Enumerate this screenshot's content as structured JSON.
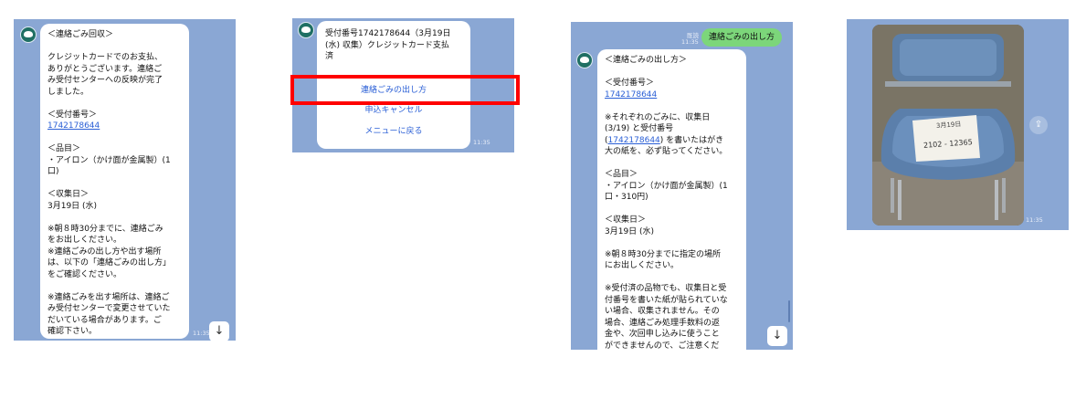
{
  "panel1": {
    "lines": [
      "＜連絡ごみ回収＞",
      "",
      "クレジットカードでのお支払、",
      "ありがとうございます。連絡ご",
      "み受付センターへの反映が完了",
      "しました。",
      "",
      "＜受付番号＞"
    ],
    "receipt_link": "1742178644",
    "lines2": [
      "",
      "＜品目＞",
      "・アイロン（かけ面が金属製）(1",
      "口)",
      "",
      "＜収集日＞",
      "3月19日 (水)",
      "",
      "※朝８時30分までに、連絡ごみ",
      "をお出しください。",
      "※連絡ごみの出し方や出す場所",
      "は、以下の「連絡ごみの出し方」",
      "をご確認ください。",
      "",
      "※連絡ごみを出す場所は、連絡ご",
      "み受付センターで変更させていた",
      "だいている場合があります。ご",
      "確認下さい。"
    ],
    "time": "11:35",
    "scroll_icon": "arrow-down-icon"
  },
  "panel2": {
    "header_lines": [
      "受付番号1742178644（3月19日",
      "(水) 収集）クレジットカード支払",
      "済"
    ],
    "menu": [
      "連絡ごみの出し方",
      "申込キャンセル",
      "メニューに戻る"
    ],
    "time": "11:35",
    "highlight_color": "#ff0000"
  },
  "panel3": {
    "read_label": "既読",
    "sent_time": "11:35",
    "sent_message": "連絡ごみの出し方",
    "lines": [
      "＜連絡ごみの出し方＞",
      "",
      "＜受付番号＞"
    ],
    "receipt_link": "1742178644",
    "lines2": [
      "",
      "※それぞれのごみに、収集日",
      "(3/19) と受付番号"
    ],
    "inline_prefix": "(",
    "inline_link": "1742178644",
    "inline_suffix": ") を書いたはがき",
    "lines3": [
      "大の紙を、必ず貼ってください。",
      "",
      "＜品目＞",
      "・アイロン（かけ面が金属製）(1",
      "口・310円)",
      "",
      "＜収集日＞",
      "3月19日 (水)",
      "",
      "※朝８時30分までに指定の場所",
      "にお出しください。",
      "",
      "※受付済の品物でも、収集日と受",
      "付番号を書いた紙が貼られていな",
      "い場合、収集されません。その",
      "場合、連絡ごみ処理手数料の返",
      "金や、次回申し込みに使うこと",
      "ができませんので、ご注意くだ"
    ],
    "scroll_icon": "arrow-down-icon"
  },
  "panel4": {
    "photo_note_line1": "3月19日",
    "photo_note_line2": "2102 - 12365",
    "time": "11:35",
    "share_icon": "share-icon"
  },
  "colors": {
    "chat_background": "#8aa7d4",
    "link": "#2a5fd6",
    "sent_bubble": "#7cd67a"
  }
}
